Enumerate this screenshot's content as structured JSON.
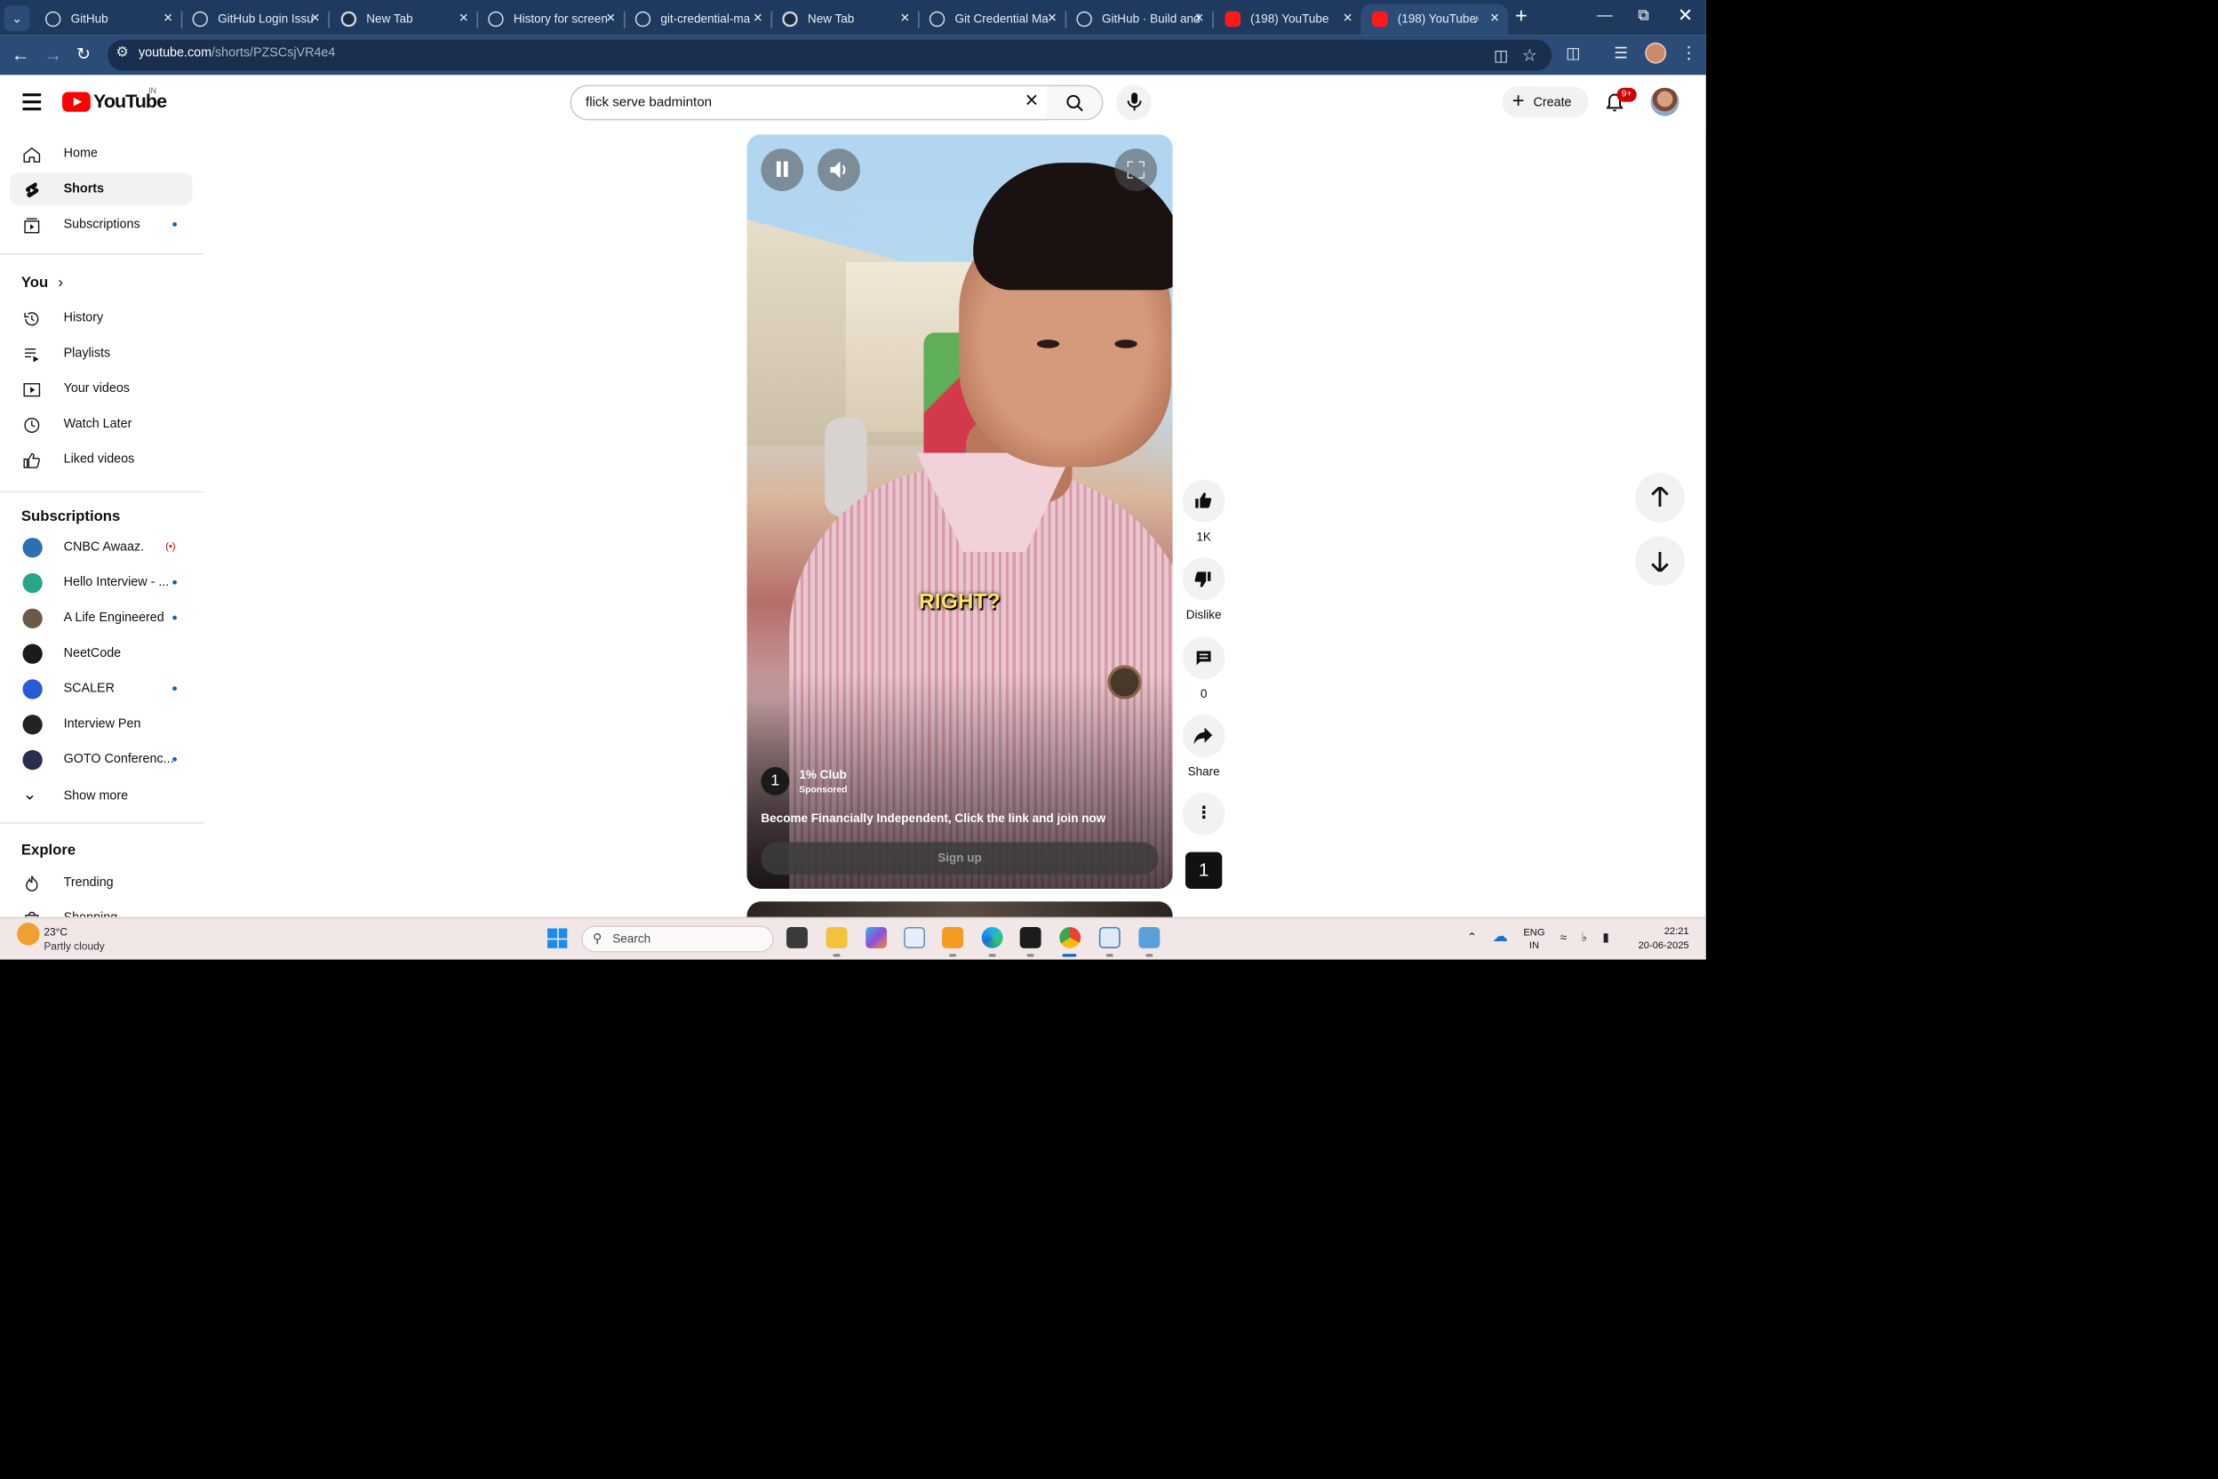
{
  "browser": {
    "tabs": [
      {
        "title": "GitHub",
        "favicon": "github-icon"
      },
      {
        "title": "GitHub Login Issu",
        "favicon": "github-icon"
      },
      {
        "title": "New Tab",
        "favicon": "chrome-icon"
      },
      {
        "title": "History for screen",
        "favicon": "github-icon"
      },
      {
        "title": "git-credential-ma",
        "favicon": "github-icon"
      },
      {
        "title": "New Tab",
        "favicon": "chrome-icon"
      },
      {
        "title": "Git Credential Ma",
        "favicon": "globe-icon"
      },
      {
        "title": "GitHub · Build and",
        "favicon": "github-icon"
      },
      {
        "title": "(198) YouTube",
        "favicon": "youtube-icon"
      },
      {
        "title": "(198) YouTube",
        "favicon": "youtube-icon",
        "active": true,
        "playing_audio": true
      }
    ],
    "url_host": "youtube.com",
    "url_path": "/shorts/PZSCsjVR4e4"
  },
  "youtube": {
    "logo_text": "YouTube",
    "country_code": "IN",
    "search_query": "flick serve badminton",
    "create_label": "Create",
    "notification_count": "9+",
    "sidebar": {
      "main": [
        {
          "label": "Home",
          "icon": "home-icon"
        },
        {
          "label": "Shorts",
          "icon": "shorts-icon",
          "selected": true
        },
        {
          "label": "Subscriptions",
          "icon": "subscriptions-icon",
          "dot": true
        }
      ],
      "you_header": "You",
      "you_items": [
        {
          "label": "History",
          "icon": "history-icon"
        },
        {
          "label": "Playlists",
          "icon": "playlists-icon"
        },
        {
          "label": "Your videos",
          "icon": "your-videos-icon"
        },
        {
          "label": "Watch Later",
          "icon": "clock-icon"
        },
        {
          "label": "Liked videos",
          "icon": "thumbs-up-icon"
        }
      ],
      "subscriptions_header": "Subscriptions",
      "subscriptions": [
        {
          "label": "CNBC Awaaz.",
          "color": "#2d6fb5",
          "live": true
        },
        {
          "label": "Hello Interview - ...",
          "color": "#27a68a",
          "dot": true
        },
        {
          "label": "A Life Engineered",
          "color": "#6b5a4a",
          "dot": true
        },
        {
          "label": "NeetCode",
          "color": "#1b1b1b",
          "dot": false
        },
        {
          "label": "SCALER",
          "color": "#2a5bd7",
          "dot": true
        },
        {
          "label": "Interview Pen",
          "color": "#222222",
          "dot": false
        },
        {
          "label": "GOTO Conferenc...",
          "color": "#2b2d4e",
          "dot": true
        }
      ],
      "show_more": "Show more",
      "explore_header": "Explore",
      "explore_items": [
        {
          "label": "Trending",
          "icon": "trending-icon"
        },
        {
          "label": "Shopping",
          "icon": "shopping-icon"
        }
      ]
    },
    "short": {
      "caption": "RIGHT?",
      "advertiser": "1% Club",
      "sponsored_label": "Sponsored",
      "ad_description": "Become Financially Independent, Click the link and join now",
      "cta_label": "Sign up",
      "advertiser_logo_text": "1"
    },
    "actions": {
      "like_count": "1K",
      "dislike_label": "Dislike",
      "comment_count": "0",
      "share_label": "Share"
    }
  },
  "taskbar": {
    "temperature": "23°C",
    "weather": "Partly cloudy",
    "search_placeholder": "Search",
    "language_top": "ENG",
    "language_bottom": "IN",
    "time": "22:21",
    "date": "20-06-2025"
  }
}
